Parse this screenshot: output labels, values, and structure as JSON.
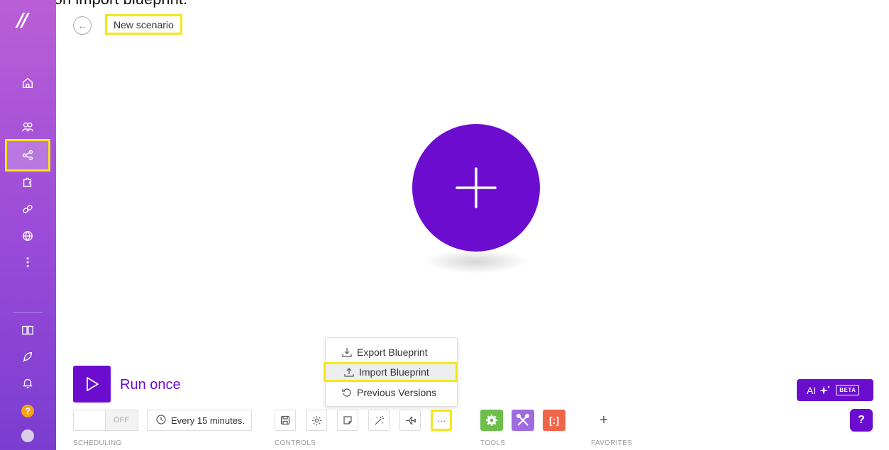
{
  "caption": "Click on import blueprint.",
  "header": {
    "back_label": "←",
    "scenario_title": "New scenario"
  },
  "sidebar": {
    "items": [
      {
        "name": "home-icon"
      },
      {
        "name": "team-icon"
      },
      {
        "name": "scenarios-icon"
      },
      {
        "name": "apps-icon"
      },
      {
        "name": "connections-icon"
      },
      {
        "name": "webhooks-icon"
      },
      {
        "name": "more-icon"
      },
      {
        "name": "docs-icon"
      },
      {
        "name": "whats-new-icon"
      },
      {
        "name": "notifications-icon"
      },
      {
        "name": "help-icon",
        "label": "?"
      },
      {
        "name": "avatar"
      }
    ]
  },
  "canvas": {
    "add_module_icon": "plus-icon"
  },
  "run": {
    "label": "Run once"
  },
  "scheduling": {
    "toggle_label": "OFF",
    "interval": "Every 15 minutes.",
    "section_label": "SCHEDULING"
  },
  "controls": {
    "section_label": "CONTROLS",
    "more_label": "···"
  },
  "menu": {
    "items": [
      {
        "label": "Export Blueprint",
        "icon": "download-icon"
      },
      {
        "label": "Import Blueprint",
        "icon": "upload-icon"
      },
      {
        "label": "Previous Versions",
        "icon": "history-icon"
      }
    ]
  },
  "tools": {
    "section_label": "TOOLS",
    "text_parser_label": "[:]"
  },
  "favorites": {
    "section_label": "FAVORITES",
    "add_label": "+"
  },
  "ai": {
    "label": "AI",
    "badge": "BETA"
  },
  "chat": {
    "label": "?"
  },
  "colors": {
    "brand": "#6b0ccf",
    "highlight": "#f4e61b",
    "tool_green": "#6cc04a",
    "tool_purple": "#a06be0",
    "tool_orange": "#f0654a"
  }
}
